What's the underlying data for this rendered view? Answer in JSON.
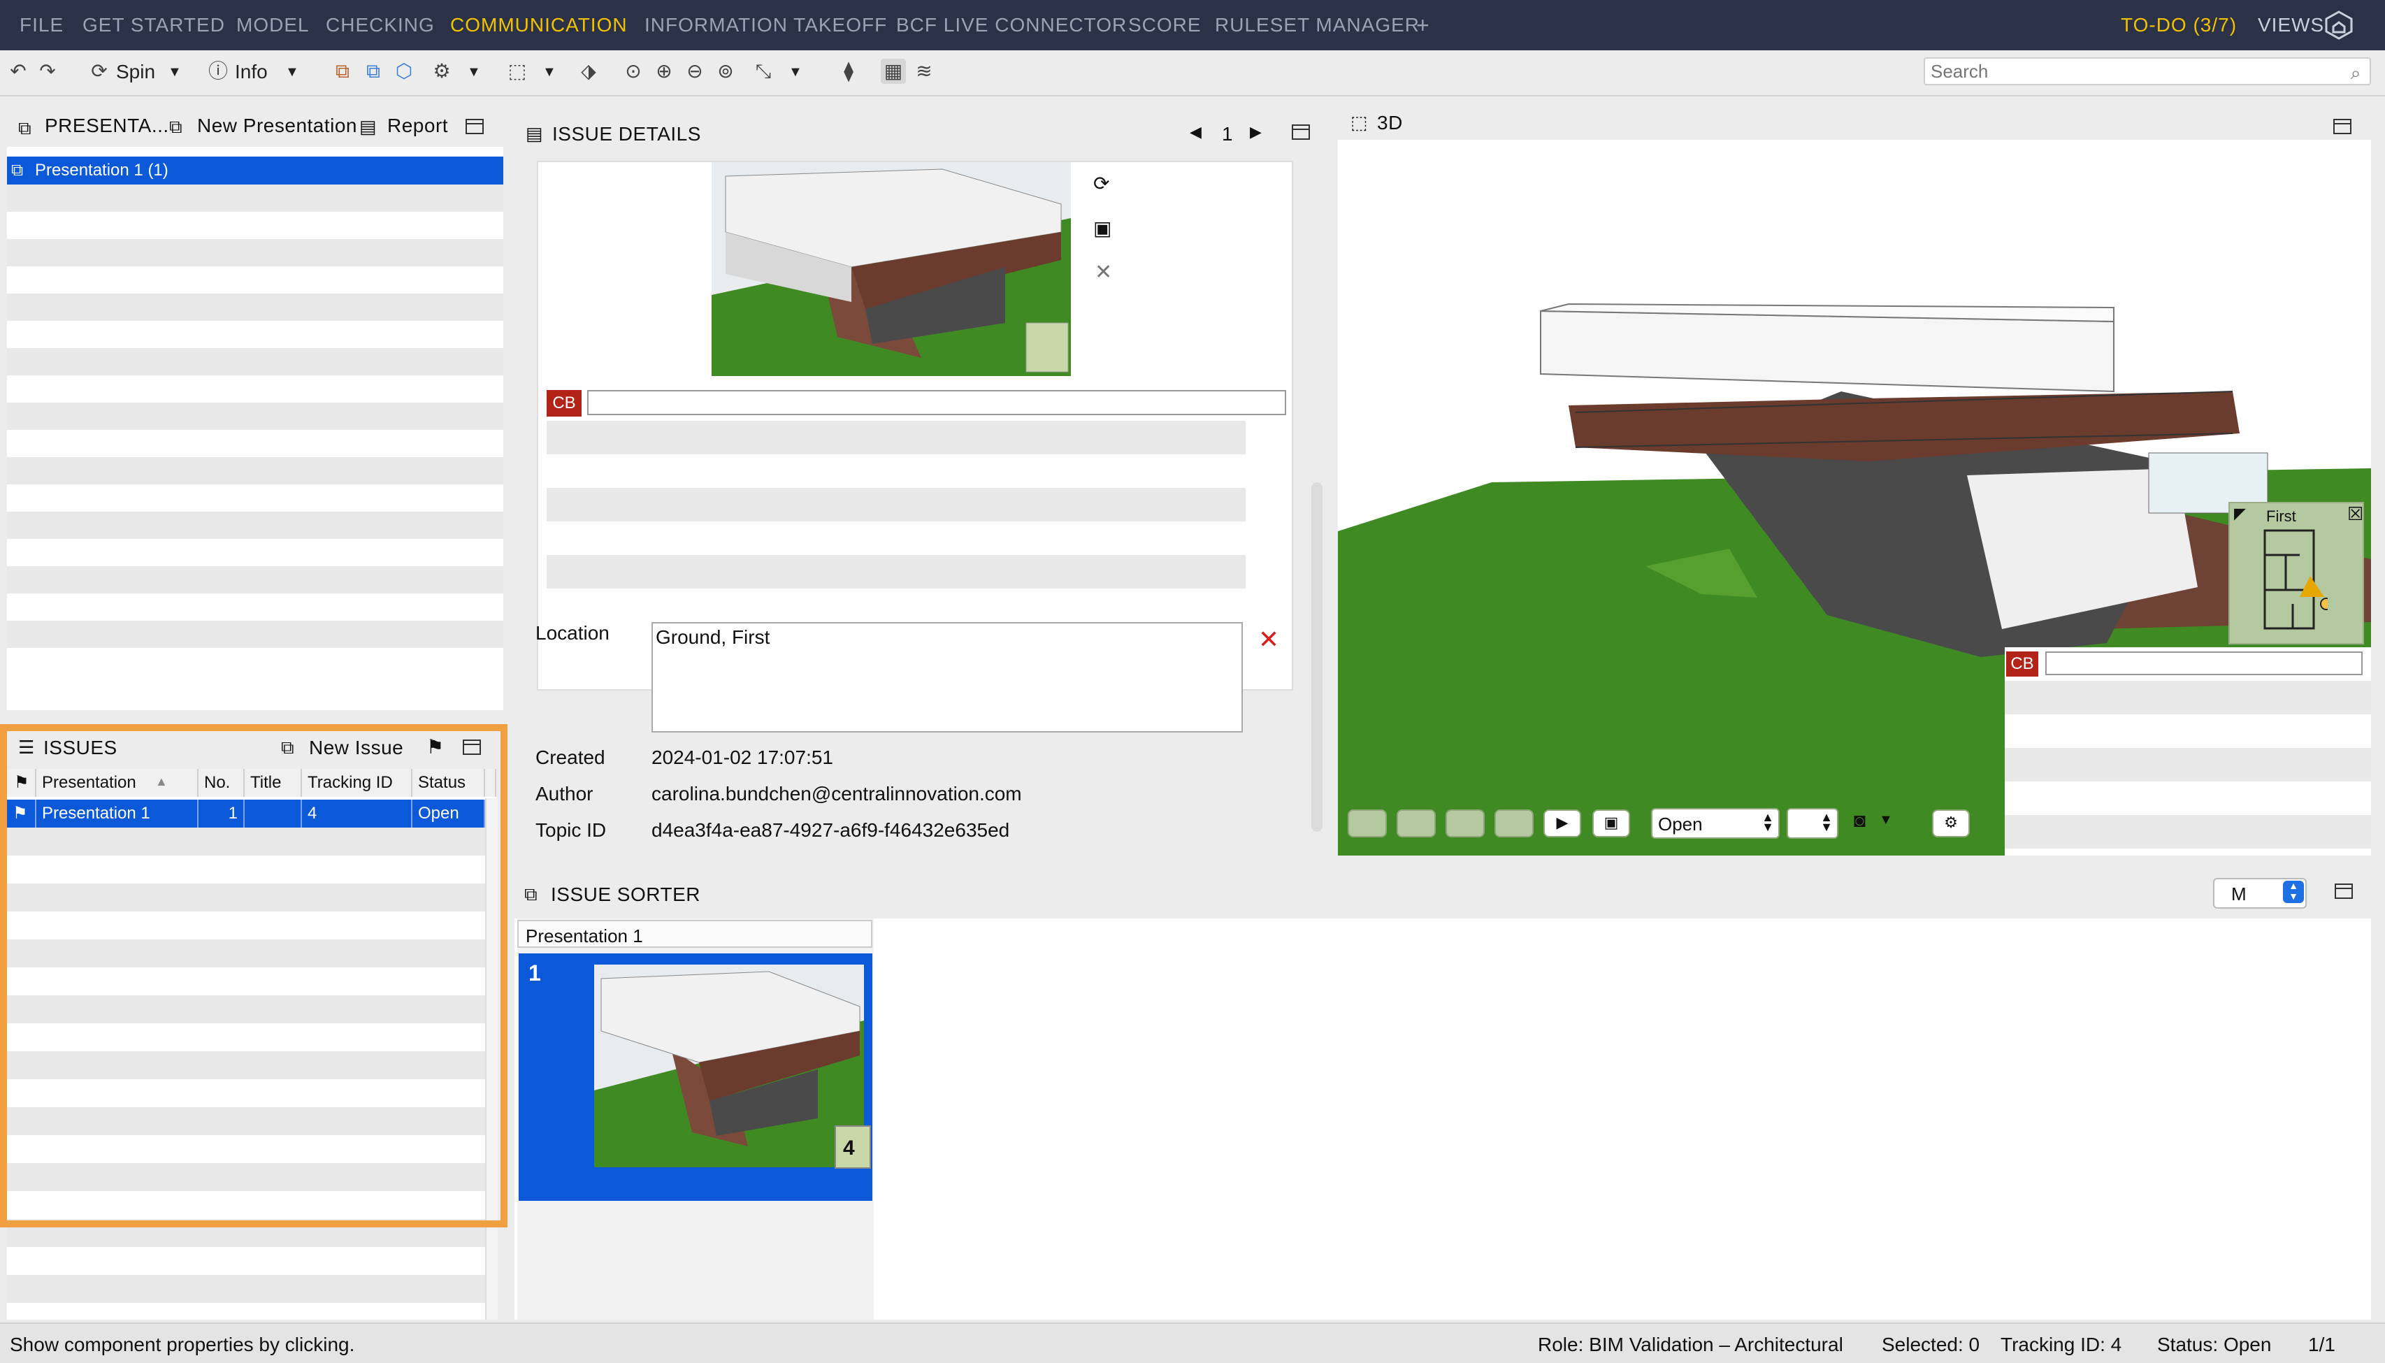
{
  "menu": {
    "items": [
      "FILE",
      "GET STARTED",
      "MODEL",
      "CHECKING",
      "COMMUNICATION",
      "INFORMATION TAKEOFF",
      "BCF LIVE CONNECTOR",
      "SCORE",
      "RULESET MANAGER"
    ],
    "active": "COMMUNICATION",
    "plus": "+",
    "todo": "TO-DO (3/7)",
    "views": "VIEWS"
  },
  "toolbar": {
    "spin_label": "Spin",
    "info_label": "Info",
    "search_placeholder": "Search"
  },
  "presentations": {
    "title": "PRESENTA...",
    "new_label": "New Presentation",
    "report_label": "Report",
    "items": [
      "Presentation 1 (1)"
    ]
  },
  "issues": {
    "title": "ISSUES",
    "new_label": "New Issue",
    "columns": [
      "Presentation",
      "No.",
      "Title",
      "Tracking ID",
      "Status"
    ],
    "rows": [
      {
        "presentation": "Presentation 1",
        "no": "1",
        "title": "",
        "tracking_id": "4",
        "status": "Open"
      }
    ]
  },
  "details": {
    "title": "ISSUE DETAILS",
    "page": "1",
    "comment_badge": "CB",
    "location_label": "Location",
    "location_value": "Ground, First",
    "created_label": "Created",
    "created_value": "2024-01-02 17:07:51",
    "author_label": "Author",
    "author_value": "carolina.bundchen@centralinnovation.com",
    "topic_label": "Topic ID",
    "topic_value": "d4ea3f4a-ea87-4927-a6f9-f46432e635ed"
  },
  "view3d": {
    "title": "3D",
    "minimap_label": "First",
    "comment_badge": "CB",
    "status_select": "Open"
  },
  "sorter": {
    "title": "ISSUE SORTER",
    "size_select": "M",
    "group_label": "Presentation 1",
    "card_number": "1",
    "card_badge": "4"
  },
  "statusbar": {
    "hint": "Show component properties by clicking.",
    "role": "Role: BIM Validation – Architectural",
    "selected": "Selected: 0",
    "tracking": "Tracking ID: 4",
    "status": "Status: Open",
    "pages": "1/1"
  },
  "colors": {
    "menubar": "#2b3247",
    "accent": "#f2c200",
    "selection": "#0b59d9",
    "highlight": "#f0a040",
    "grass": "#3f8a22",
    "badge": "#b42318"
  }
}
